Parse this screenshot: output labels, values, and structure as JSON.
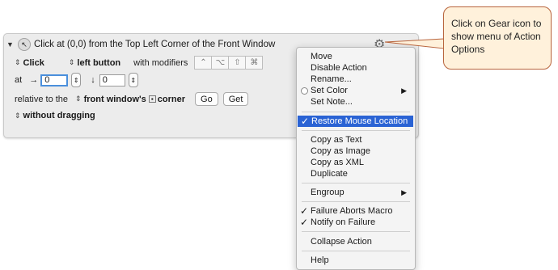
{
  "action": {
    "title": "Click at (0,0) from the Top Left Corner of the Front Window",
    "click_type": "Click",
    "button": "left button",
    "modifiers_label": "with modifiers",
    "modifier_keys": [
      "⌃",
      "⌥",
      "⇧",
      "⌘"
    ],
    "at_label": "at",
    "x_arrow": "→",
    "x_value": "0",
    "y_arrow": "↓",
    "y_value": "0",
    "relative_label": "relative to the",
    "relative_target": "front window's",
    "corner_label": "corner",
    "go_button": "Go",
    "get_button": "Get",
    "drag_option": "without dragging"
  },
  "menu": {
    "items": [
      {
        "label": "Move"
      },
      {
        "label": "Disable Action"
      },
      {
        "label": "Rename..."
      },
      {
        "label": "Set Color",
        "submenu": "▶"
      },
      {
        "label": "Set Note..."
      },
      {
        "label": "Restore Mouse Location",
        "check": "✓"
      },
      {
        "label": "Copy as Text"
      },
      {
        "label": "Copy as Image"
      },
      {
        "label": "Copy as XML"
      },
      {
        "label": "Duplicate"
      },
      {
        "label": "Engroup",
        "submenu": "▶"
      },
      {
        "label": "Failure Aborts Macro",
        "check": "✓"
      },
      {
        "label": "Notify on Failure",
        "check": "✓"
      },
      {
        "label": "Collapse Action"
      },
      {
        "label": "Help"
      }
    ]
  },
  "callout": {
    "text": "Click on Gear icon to show menu of Action Options"
  },
  "icons": {
    "gear": "gear-icon",
    "disclosure": "triangle-down-icon",
    "action": "mouse-click-icon"
  },
  "colors": {
    "highlight": "#2a63d4",
    "callout_fill": "#fff1db",
    "callout_border": "#b8643c",
    "focus_ring": "#4a8fdc"
  }
}
